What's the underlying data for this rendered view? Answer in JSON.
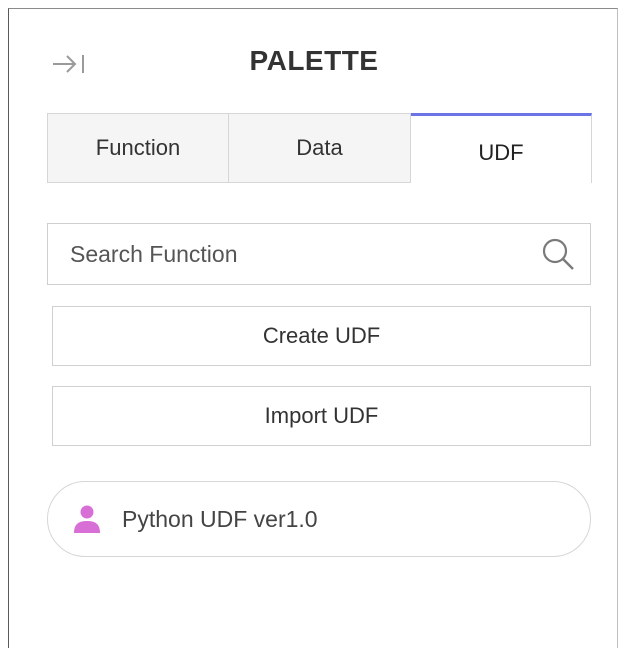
{
  "header": {
    "title": "PALETTE",
    "collapse_icon": "collapse-right-icon"
  },
  "tabs": [
    {
      "label": "Function",
      "active": false
    },
    {
      "label": "Data",
      "active": false
    },
    {
      "label": "UDF",
      "active": true
    }
  ],
  "search": {
    "placeholder": "Search Function",
    "value": "",
    "icon": "search-icon"
  },
  "actions": {
    "create_label": "Create UDF",
    "import_label": "Import UDF"
  },
  "udf_list": [
    {
      "label": "Python UDF ver1.0",
      "icon": "person-icon"
    }
  ],
  "colors": {
    "active_tab_accent": "#6b73e6",
    "person_icon": "#d86fd6",
    "border": "#d6d6d6"
  }
}
